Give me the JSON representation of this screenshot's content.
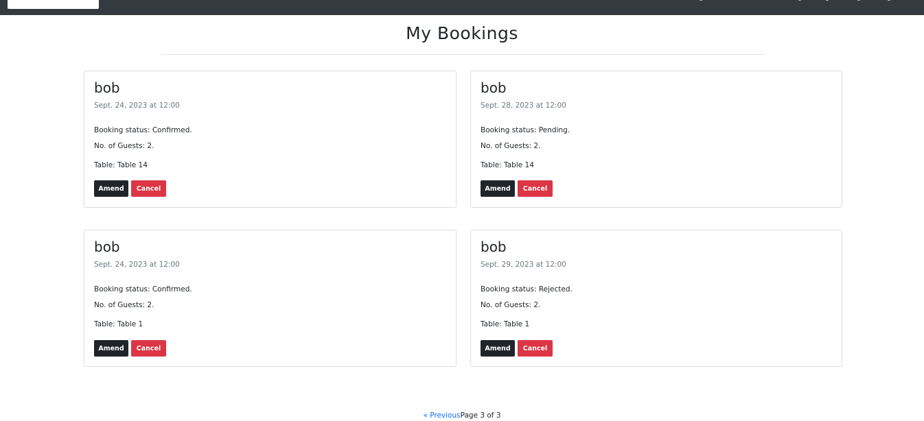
{
  "navbar": {
    "brand_bg": "#ffffff",
    "bar_color": "#343a40"
  },
  "page": {
    "title": "My Bookings"
  },
  "bookings": [
    {
      "name": "bob",
      "date": "Sept. 24, 2023 at 12:00",
      "status": "Booking status: Confirmed.",
      "guests": "No. of Guests: 2.",
      "table": "Table: Table 14",
      "amend_label": "Amend",
      "cancel_label": "Cancel"
    },
    {
      "name": "bob",
      "date": "Sept. 28, 2023 at 12:00",
      "status": "Booking status: Pending.",
      "guests": "No. of Guests: 2.",
      "table": "Table: Table 14",
      "amend_label": "Amend",
      "cancel_label": "Cancel"
    },
    {
      "name": "bob",
      "date": "Sept. 24, 2023 at 12:00",
      "status": "Booking status: Confirmed.",
      "guests": "No. of Guests: 2.",
      "table": "Table: Table 1",
      "amend_label": "Amend",
      "cancel_label": "Cancel"
    },
    {
      "name": "bob",
      "date": "Sept. 29, 2023 at 12:00",
      "status": "Booking status: Rejected.",
      "guests": "No. of Guests: 2.",
      "table": "Table: Table 1",
      "amend_label": "Amend",
      "cancel_label": "Cancel"
    }
  ],
  "pagination": {
    "previous_label": "« Previous",
    "page_info": "Page 3 of 3"
  },
  "colors": {
    "amend_button": "#212529",
    "cancel_button": "#dc3545",
    "link": "#0d6efd",
    "muted_text": "#6c757d"
  }
}
